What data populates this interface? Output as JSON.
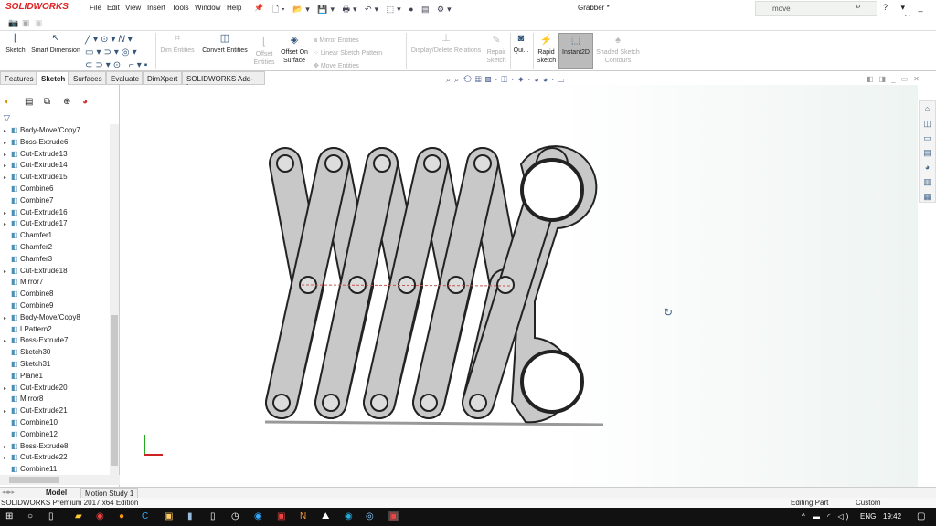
{
  "app": {
    "logo": "SOLIDWORKS",
    "document_title": "Grabber *"
  },
  "menu": [
    "File",
    "Edit",
    "View",
    "Insert",
    "Tools",
    "Window",
    "Help"
  ],
  "quick_access_icons": "🗋▾ 📂▾ 💾▾ 🖶▾ ↶▾ ⬚▾ ● ▤ ⚙▾",
  "search": {
    "value": "move"
  },
  "window_controls": "? ▾ _ ▭ ✕",
  "ribbon": {
    "sketch": "Sketch",
    "smart_dimension": "Smart Dimension",
    "dim_entities": "Dim Entities",
    "convert_entities": "Convert Entities",
    "offset_entities": "Offset Entities",
    "offset_on_surface": "Offset On Surface",
    "mirror_entities": "Mirror Entities",
    "linear_sketch_pattern": "Linear Sketch Pattern",
    "move_entities": "Move Entities",
    "display_delete_relations": "Display/Delete Relations",
    "repair_sketch": "Repair Sketch",
    "quick_snaps": "Qui...",
    "rapid_sketch": "Rapid Sketch",
    "instant2d": "Instant2D",
    "shaded_sketch_contours": "Shaded Sketch Contours"
  },
  "tabs": [
    "Features",
    "Sketch",
    "Surfaces",
    "Evaluate",
    "DimXpert",
    "SOLIDWORKS Add-Ins"
  ],
  "feature_tree": [
    {
      "label": "Body-Move/Copy7",
      "arrow": true
    },
    {
      "label": "Boss-Extrude6",
      "arrow": true
    },
    {
      "label": "Cut-Extrude13",
      "arrow": true
    },
    {
      "label": "Cut-Extrude14",
      "arrow": true
    },
    {
      "label": "Cut-Extrude15",
      "arrow": true
    },
    {
      "label": "Combine6",
      "arrow": false
    },
    {
      "label": "Combine7",
      "arrow": false
    },
    {
      "label": "Cut-Extrude16",
      "arrow": true
    },
    {
      "label": "Cut-Extrude17",
      "arrow": true
    },
    {
      "label": "Chamfer1",
      "arrow": false
    },
    {
      "label": "Chamfer2",
      "arrow": false
    },
    {
      "label": "Chamfer3",
      "arrow": false
    },
    {
      "label": "Cut-Extrude18",
      "arrow": true
    },
    {
      "label": "Mirror7",
      "arrow": false
    },
    {
      "label": "Combine8",
      "arrow": false
    },
    {
      "label": "Combine9",
      "arrow": false
    },
    {
      "label": "Body-Move/Copy8",
      "arrow": true
    },
    {
      "label": "LPattern2",
      "arrow": false
    },
    {
      "label": "Boss-Extrude7",
      "arrow": true
    },
    {
      "label": "Sketch30",
      "arrow": false
    },
    {
      "label": "Sketch31",
      "arrow": false
    },
    {
      "label": "Plane1",
      "arrow": false
    },
    {
      "label": "Cut-Extrude20",
      "arrow": true
    },
    {
      "label": "Mirror8",
      "arrow": false
    },
    {
      "label": "Cut-Extrude21",
      "arrow": true
    },
    {
      "label": "Combine10",
      "arrow": false
    },
    {
      "label": "Combine12",
      "arrow": false
    },
    {
      "label": "Boss-Extrude8",
      "arrow": true
    },
    {
      "label": "Cut-Extrude22",
      "arrow": true
    },
    {
      "label": "Combine11",
      "arrow": false
    }
  ],
  "bottom_tabs": [
    "Model",
    "Motion Study 1"
  ],
  "status": {
    "edition": "SOLIDWORKS Premium 2017 x64 Edition",
    "mode": "Editing Part",
    "units": "Custom"
  },
  "taskbar": {
    "language": "ENG",
    "time": "19:42"
  },
  "colors": {
    "accent": "#d22",
    "part_fill": "#c8c8c8",
    "taskbar": "#111"
  }
}
